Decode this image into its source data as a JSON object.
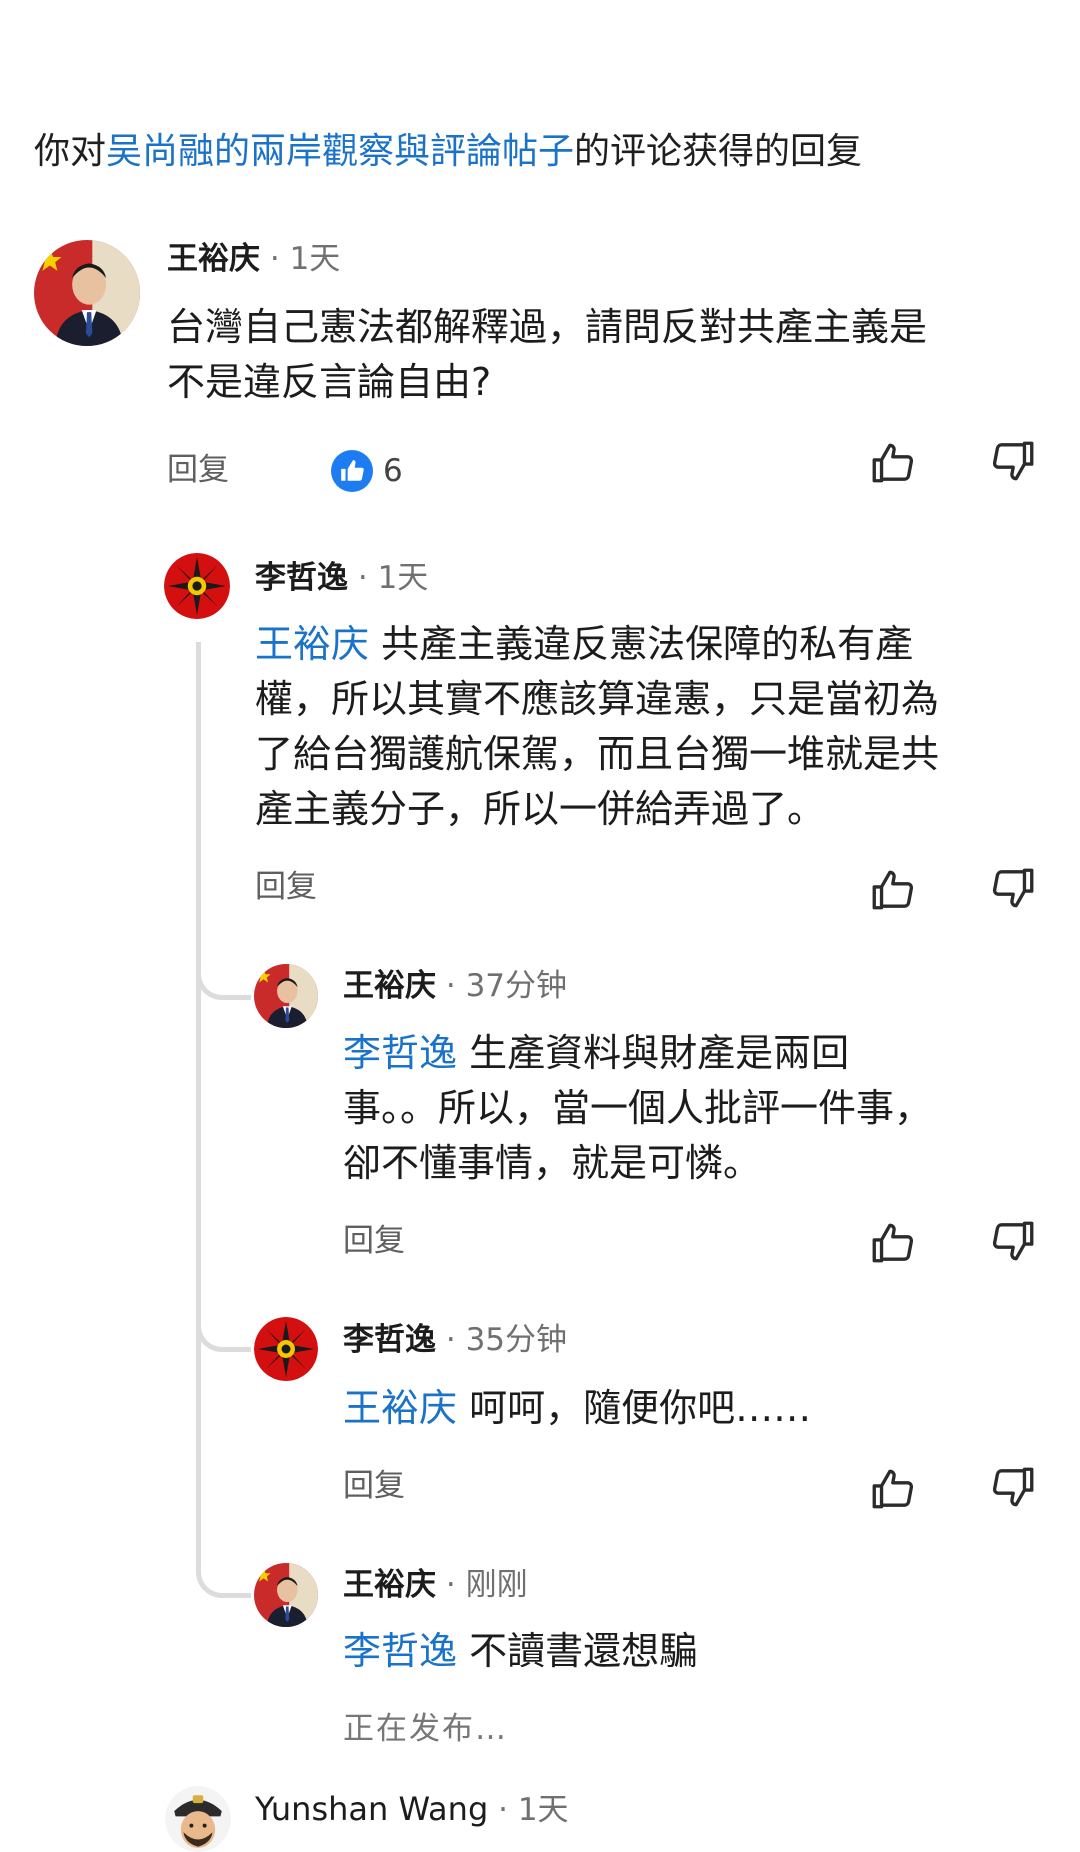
{
  "header": {
    "prefix": "你对",
    "post_link": "吴尚融的兩岸觀察與評論帖子",
    "suffix": "的评论获得的回复"
  },
  "comments": [
    {
      "author": "王裕庆",
      "time": "· 1天",
      "mention": "",
      "lines": [
        "台灣自己憲法都解釋過，請問反對共產主義是",
        "不是違反言論自由?"
      ],
      "reply_label": "回复",
      "like_count": "6"
    },
    {
      "author": "李哲逸",
      "time": "· 1天",
      "mention": "王裕庆",
      "lines": [
        " 共產主義違反憲法保障的私有產",
        "權，所以其實不應該算違憲，只是當初為",
        "了給台獨護航保駕，而且台獨一堆就是共",
        "產主義分子，所以一併給弄過了。"
      ],
      "reply_label": "回复"
    },
    {
      "author": "王裕庆",
      "time": "· 37分钟",
      "mention": "李哲逸",
      "lines": [
        " 生產資料與財產是兩回",
        "事。。所以，當一個人批評一件事，",
        "卻不懂事情，就是可憐。"
      ],
      "reply_label": "回复"
    },
    {
      "author": "李哲逸",
      "time": "· 35分钟",
      "mention": "王裕庆",
      "lines": [
        " 呵呵，隨便你吧……"
      ],
      "reply_label": "回复"
    },
    {
      "author": "王裕庆",
      "time": "· 刚刚",
      "mention": "李哲逸",
      "lines": [
        " 不讀書還想騙"
      ],
      "status": "正在发布…"
    },
    {
      "author": "Yunshan Wang",
      "time": "· 1天"
    }
  ],
  "icons": {
    "like": "thumbs-up-icon",
    "dislike": "thumbs-down-icon",
    "like_badge": "like-badge-icon"
  },
  "colors": {
    "link": "#1a73c9",
    "like_badge": "#1e7cf2",
    "thread_line": "#dcdcdc"
  }
}
